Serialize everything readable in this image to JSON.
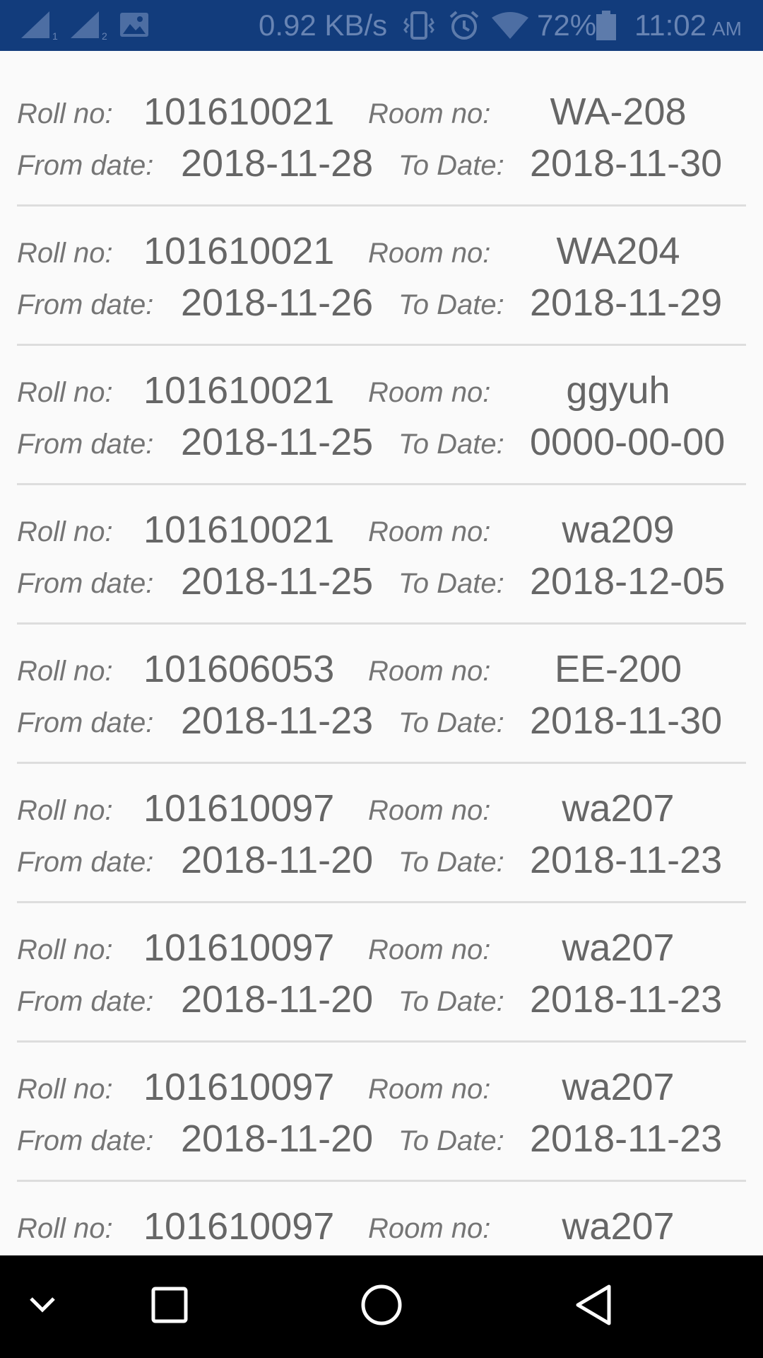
{
  "status_bar": {
    "network_speed": "0.92 KB/s",
    "battery_percent": "72%",
    "time": "11:02",
    "ampm": "AM",
    "icons": [
      "signal-sim1-icon",
      "signal-sim2-icon",
      "image-notification-icon",
      "vibrate-icon",
      "alarm-icon",
      "wifi-icon",
      "battery-icon"
    ]
  },
  "labels": {
    "roll": "Roll no:",
    "room": "Room no:",
    "from": "From date:",
    "to": "To Date:"
  },
  "bookings": [
    {
      "roll": "101610021",
      "room": "WA-208",
      "from": "2018-11-28",
      "to": "2018-11-30"
    },
    {
      "roll": "101610021",
      "room": "WA204",
      "from": "2018-11-26",
      "to": "2018-11-29"
    },
    {
      "roll": "101610021",
      "room": "ggyuh",
      "from": "2018-11-25",
      "to": "0000-00-00"
    },
    {
      "roll": "101610021",
      "room": "wa209",
      "from": "2018-11-25",
      "to": "2018-12-05"
    },
    {
      "roll": "101606053",
      "room": "EE-200",
      "from": "2018-11-23",
      "to": "2018-11-30"
    },
    {
      "roll": "101610097",
      "room": "wa207",
      "from": "2018-11-20",
      "to": "2018-11-23"
    },
    {
      "roll": "101610097",
      "room": "wa207",
      "from": "2018-11-20",
      "to": "2018-11-23"
    },
    {
      "roll": "101610097",
      "room": "wa207",
      "from": "2018-11-20",
      "to": "2018-11-23"
    },
    {
      "roll": "101610097",
      "room": "wa207",
      "from": "",
      "to": ""
    }
  ],
  "nav_bar": {
    "icons": [
      "hide-keyboard-icon",
      "recents-icon",
      "home-icon",
      "back-icon"
    ]
  },
  "colors": {
    "status_bar": "#123c7c",
    "nav_bar": "#000000",
    "background": "#fafafa",
    "label_text": "#757575",
    "value_text": "#666666",
    "divider": "#dddddd"
  }
}
